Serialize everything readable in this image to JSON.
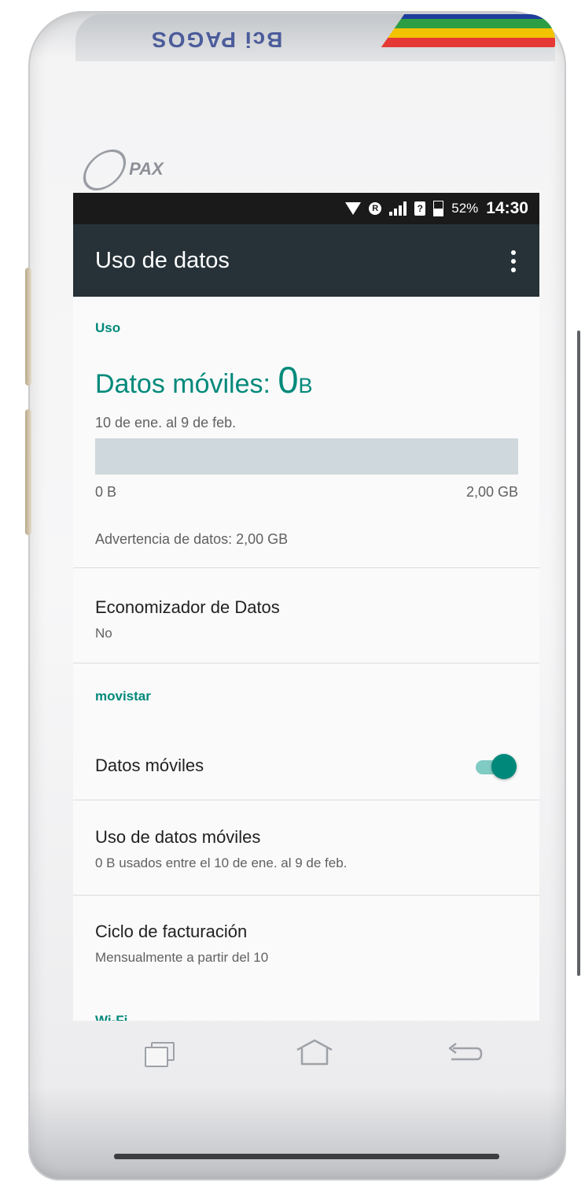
{
  "device": {
    "brand_text": "Bci PAGOS",
    "maker_logo": "PAX",
    "brand_colors": [
      "#1f3e9b",
      "#2e9e45",
      "#f2c300",
      "#e53935"
    ]
  },
  "statusbar": {
    "battery_percent": "52%",
    "time": "14:30",
    "sim_badge": "?",
    "icons": [
      "wifi-icon",
      "roaming-icon",
      "signal-icon",
      "sim-icon",
      "battery-icon"
    ]
  },
  "appbar": {
    "title": "Uso de datos",
    "overflow_icon": "more-vert-icon"
  },
  "usage": {
    "section_header": "Uso",
    "label": "Datos móviles: ",
    "amount": "0",
    "unit": "B",
    "period": "10 de ene. al 9 de feb.",
    "bar_min": "0 B",
    "bar_max": "2,00 GB",
    "used_fraction": 0,
    "warning": "Advertencia de datos: 2,00 GB"
  },
  "data_saver": {
    "title": "Economizador de Datos",
    "value": "No"
  },
  "carrier": {
    "section_header": "movistar",
    "mobile_data": {
      "title": "Datos móviles",
      "enabled": true
    },
    "mobile_usage": {
      "title": "Uso de datos móviles",
      "summary": "0 B usados entre el 10 de ene. al 9 de feb."
    },
    "billing_cycle": {
      "title": "Ciclo de facturación",
      "summary": "Mensualmente a partir del 10"
    }
  },
  "next_section_header_peek": "Wi-Fi",
  "colors": {
    "accent": "#00897b",
    "appbar": "#263238",
    "statusbar": "#1a1a1a",
    "toggle_track": "#80cbc4"
  },
  "navbar": [
    "recent-apps-icon",
    "home-icon",
    "back-icon"
  ]
}
